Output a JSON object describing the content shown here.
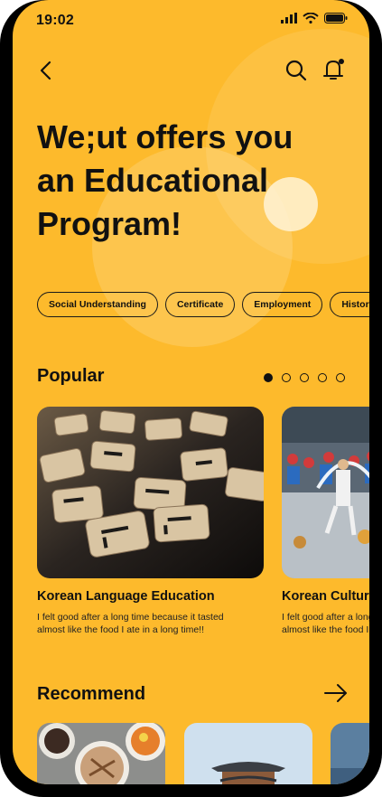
{
  "status": {
    "time": "19:02"
  },
  "hero": {
    "line1": "We;ut offers you",
    "line2": "an Educational",
    "line3": "Program!"
  },
  "chips": [
    "Social Understanding",
    "Certificate",
    "Employment",
    "History"
  ],
  "popular": {
    "title": "Popular",
    "dots_total": 5,
    "dots_active": 1,
    "cards": [
      {
        "title": "Korean Language Education",
        "desc": "I felt good after a long time because it tasted almost like the food I ate in a long time!!"
      },
      {
        "title": "Korean Cultural",
        "desc": "I felt good after a long time because it tasted almost like the food I ate in a long time!!"
      }
    ]
  },
  "recommend": {
    "title": "Recommend"
  },
  "colors": {
    "background": "#FDBA2C",
    "text": "#111111"
  },
  "icons": [
    "back-arrow-icon",
    "search-icon",
    "bell-icon",
    "arrow-right-icon",
    "signal-icon",
    "wifi-icon",
    "battery-icon"
  ]
}
